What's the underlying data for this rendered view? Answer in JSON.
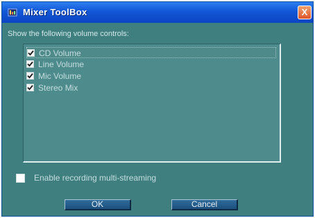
{
  "window": {
    "title": "Mixer ToolBox",
    "close_label": "X"
  },
  "instruction": "Show the following volume controls:",
  "volume_controls": [
    {
      "label": "CD Volume",
      "checked": true,
      "selected": true
    },
    {
      "label": "Line Volume",
      "checked": true,
      "selected": false
    },
    {
      "label": "Mic Volume",
      "checked": true,
      "selected": false
    },
    {
      "label": "Stereo Mix",
      "checked": true,
      "selected": false
    }
  ],
  "option": {
    "label": "Enable recording multi-streaming",
    "checked": false
  },
  "buttons": {
    "ok_label": "OK",
    "cancel_label": "Cancel"
  },
  "colors": {
    "dialog_background": "#3f7f80",
    "titlebar": "#1257d6",
    "close_button": "#e0562a",
    "button": "#1c4f7d"
  },
  "icons": {
    "title": "app-icon",
    "close": "close-icon",
    "check": "checkmark-icon"
  }
}
